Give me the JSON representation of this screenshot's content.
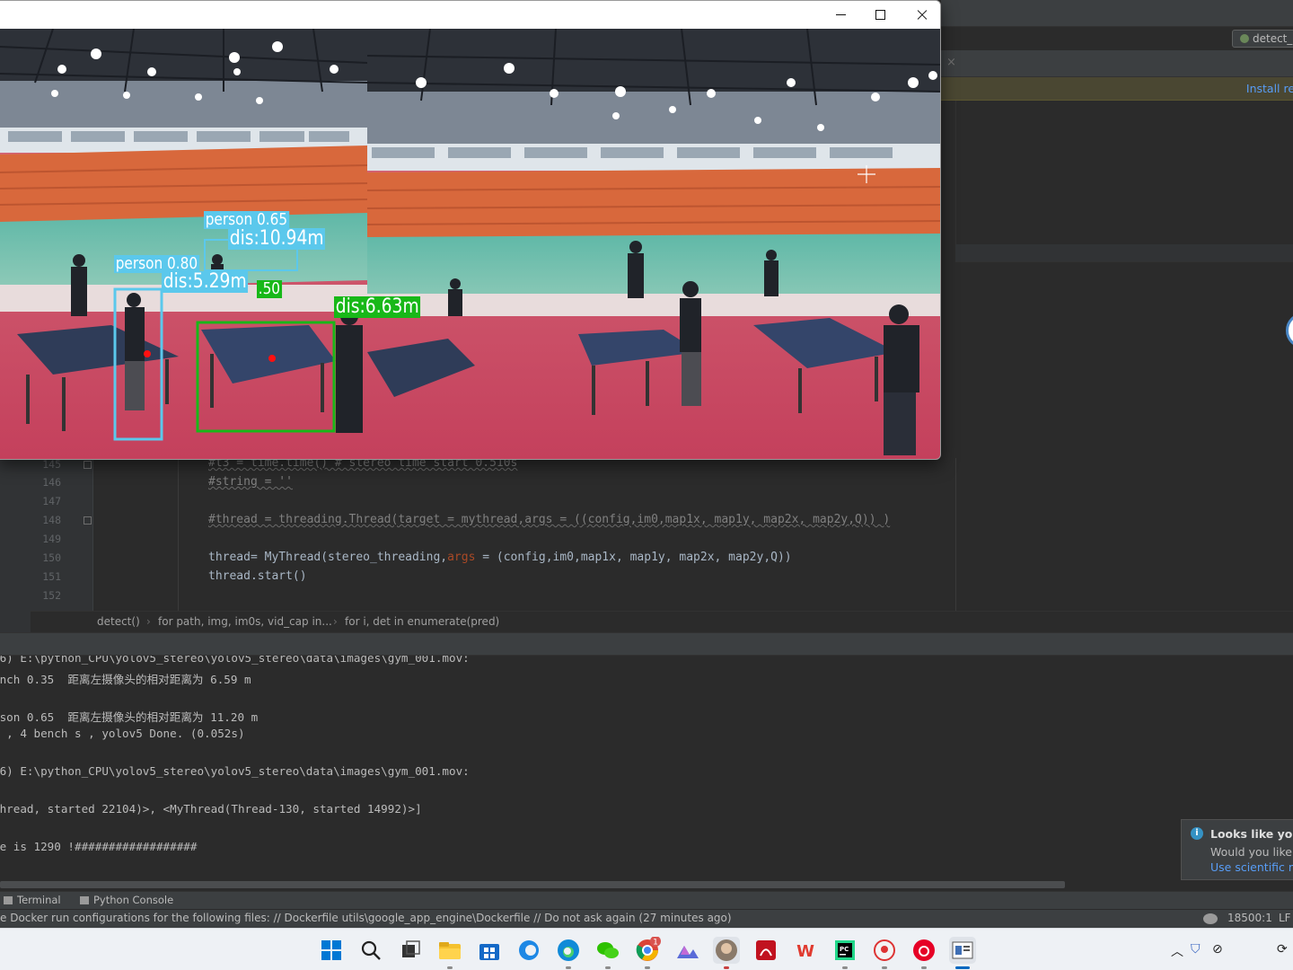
{
  "ide": {
    "run_config": "detect_",
    "banner_link": "Install req",
    "editor": {
      "lines": [
        {
          "num": "145",
          "text": "#t3 = time.time() # stereo time start 0.510s"
        },
        {
          "num": "146",
          "text": "#string = ''"
        },
        {
          "num": "147",
          "text": ""
        },
        {
          "num": "148",
          "text": "#thread = threading.Thread(target = mythread,args = ((config,im0,map1x, map1y, map2x, map2y,Q)) )"
        },
        {
          "num": "149",
          "text": ""
        },
        {
          "num": "150",
          "text_a": "thread= MyThread(stereo_threading,",
          "kw": "args",
          "text_b": " = (config,im0,map1x, map1y, map2x, map2y,Q))"
        },
        {
          "num": "151",
          "text": "thread.start()"
        },
        {
          "num": "152",
          "text": ""
        }
      ]
    },
    "breadcrumb": [
      "detect()",
      "for path, img, im0s, vid_cap in...",
      "for i, det in enumerate(pred)"
    ],
    "console_lines": [
      "l6) E:\\python_CPU\\yolov5_stereo\\yolov5_stereo\\data\\images\\gym_001.mov:",
      "ench 0.35  距离左摄像头的相对距离为 6.59 m",
      "",
      "rson 0.65  距离左摄像头的相对距离为 11.20 m",
      "s , 4 bench s , yolov5 Done. (0.052s)",
      "!",
      "l6) E:\\python_CPU\\yolov5_stereo\\yolov5_stereo\\data\\images\\gym_001.mov:",
      "",
      "Thread, started 22104)>, <MyThread(Thread-130, started 14992)>]",
      "",
      "me is 1290 !##################"
    ],
    "tool_tabs": [
      "Terminal",
      "Python Console"
    ],
    "status_message": "e Docker run configurations for the following files: // Dockerfile utils\\google_app_engine\\Dockerfile // Do not ask again (27 minutes ago)",
    "status_position": "18500:1",
    "status_line_ending": "LF",
    "notification": {
      "title": "Looks like you'",
      "body": "Would you like t",
      "link": "Use scientific mo"
    }
  },
  "viewer": {
    "detections": [
      {
        "label": "person 0.65",
        "distance": "dis:10.94m",
        "color": "#5bc8ec"
      },
      {
        "label": "person 0.80",
        "distance": "dis:5.29m",
        "color": "#5bc8ec"
      },
      {
        "label": ".50",
        "distance": "dis:6.63m",
        "color": "#18b818"
      }
    ]
  },
  "taskbar": {
    "apps": [
      "start-icon",
      "search-icon",
      "task-view-icon",
      "file-explorer-icon",
      "microsoft-store-icon",
      "browser-icon",
      "edge-icon",
      "wechat-icon",
      "chrome-icon",
      "photo-app-icon",
      "profile-app-icon",
      "acrobat-icon",
      "wps-icon",
      "pycharm-icon",
      "game-app-icon",
      "netease-music-icon",
      "image-viewer-icon"
    ],
    "chrome_badge": "1"
  }
}
